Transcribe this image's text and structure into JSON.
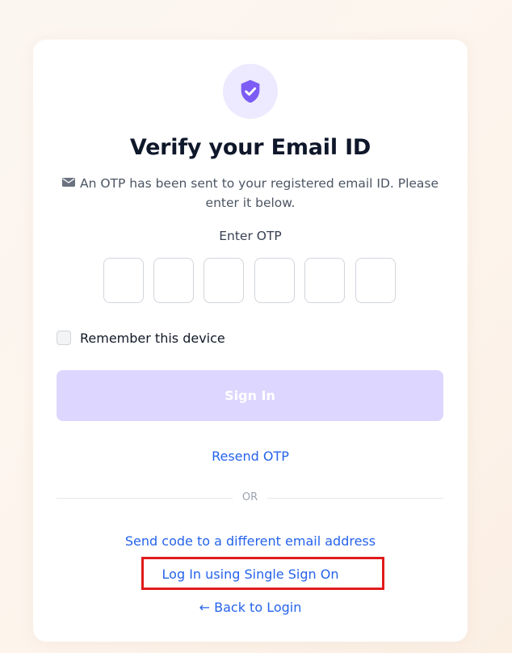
{
  "header": {
    "icon": "shield-check-icon",
    "title": "Verify your Email ID",
    "subtitle": "An OTP has been sent to your registered email ID. Please enter it below."
  },
  "otp": {
    "label": "Enter OTP",
    "digits": [
      "",
      "",
      "",
      "",
      "",
      ""
    ]
  },
  "remember": {
    "label": "Remember this device",
    "checked": false
  },
  "actions": {
    "sign_in_label": "Sign In",
    "resend_label": "Resend OTP",
    "divider_label": "OR",
    "different_email_label": "Send code to a different email address",
    "sso_label": "Log In using Single Sign On",
    "back_label": "← Back to Login"
  },
  "colors": {
    "accent": "#7c5cf4",
    "accent_light": "#ede9fe",
    "button_disabled": "#ddd6fe",
    "link": "#2563eb",
    "highlight": "#e01b1b"
  }
}
